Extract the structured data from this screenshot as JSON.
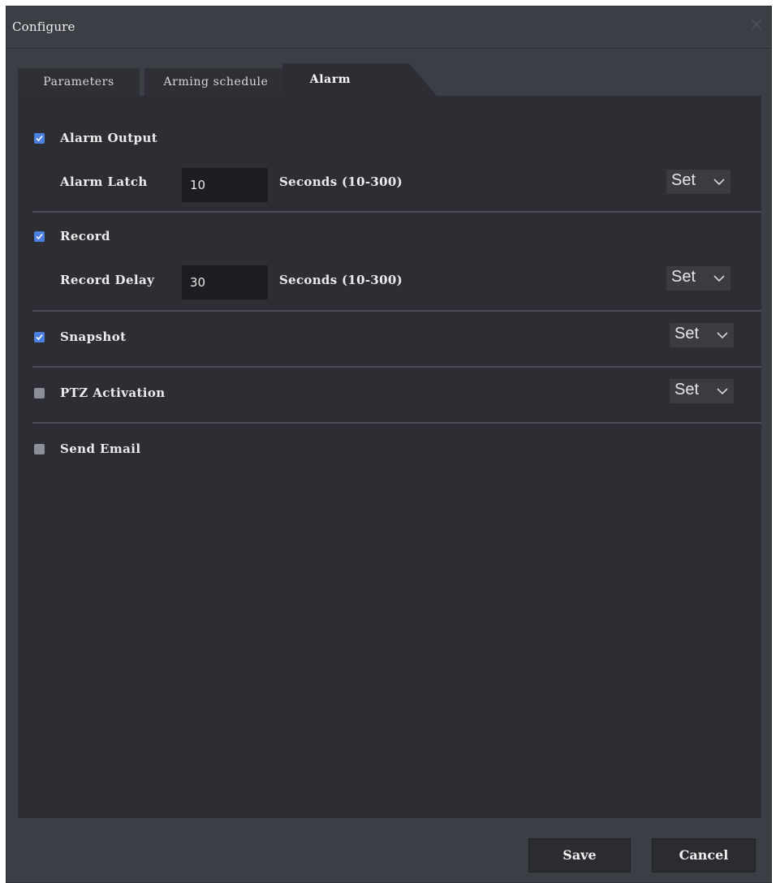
{
  "window": {
    "title": "Configure",
    "close_icon": "close-icon"
  },
  "tabs": [
    {
      "label": "Parameters",
      "active": false
    },
    {
      "label": "Arming schedule",
      "active": false
    },
    {
      "label": "Alarm",
      "active": true
    }
  ],
  "alarm": {
    "alarm_output": {
      "label": "Alarm Output",
      "checked": true
    },
    "alarm_latch": {
      "label": "Alarm Latch",
      "value": "10",
      "unit": "Seconds (10-300)",
      "set_label": "Set"
    },
    "record": {
      "label": "Record",
      "checked": true
    },
    "record_delay": {
      "label": "Record Delay",
      "value": "30",
      "unit": "Seconds (10-300)",
      "set_label": "Set"
    },
    "snapshot": {
      "label": "Snapshot",
      "checked": true,
      "set_label": "Set"
    },
    "ptz_activation": {
      "label": "PTZ Activation",
      "checked": false,
      "set_label": "Set"
    },
    "send_email": {
      "label": "Send Email",
      "checked": false
    }
  },
  "footer": {
    "save_label": "Save",
    "cancel_label": "Cancel"
  },
  "colors": {
    "dialog_bg": "#3b3e44",
    "panel_bg": "#2c2e33",
    "checkbox_on": "#4a7fe0",
    "checkbox_off": "#8c8f96"
  }
}
